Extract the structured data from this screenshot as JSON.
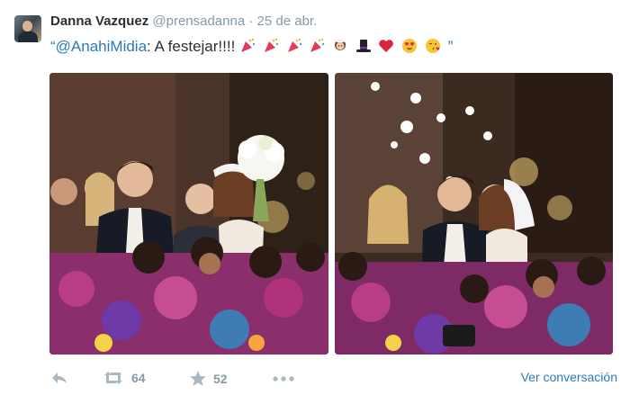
{
  "tweet": {
    "author_name": "Danna Vazquez",
    "author_handle": "@prensadanna",
    "separator": "·",
    "date": "25 de abr.",
    "quote_open": "“",
    "mention": "@AnahiMidia",
    "text_after_mention": ": A festejar!!!!",
    "quote_close": "”",
    "emojis": [
      "party-popper",
      "party-popper",
      "party-popper",
      "party-popper",
      "bride-with-veil",
      "top-hat",
      "red-heart",
      "heart-eyes-face",
      "face-blowing-kiss"
    ]
  },
  "photos": [
    {
      "name": "wedding-photo-couple-bouquet"
    },
    {
      "name": "wedding-photo-couple-kiss"
    }
  ],
  "actions": {
    "reply_icon": "reply-icon",
    "retweet_icon": "retweet-icon",
    "retweet_count": "64",
    "favorite_icon": "star-icon",
    "favorite_count": "52",
    "more_icon": "more-dots-icon",
    "view_conversation": "Ver conversación"
  },
  "colors": {
    "link": "#2b7bb9",
    "muted": "#8899a6",
    "text": "#292f33"
  }
}
